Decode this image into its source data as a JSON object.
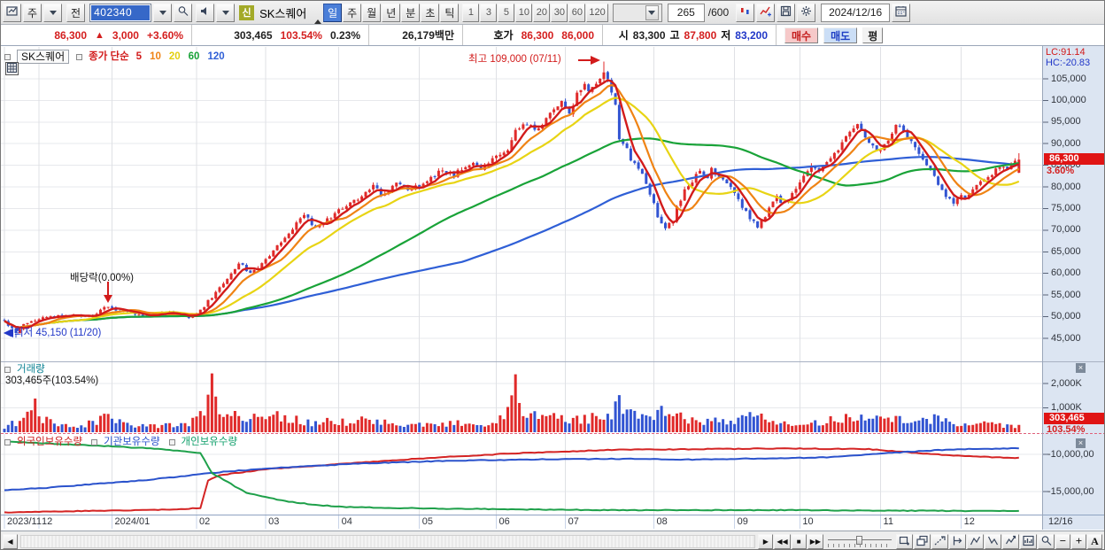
{
  "colors": {
    "up": "#e02a2a",
    "down": "#3254d2",
    "axis_bg": "#dce5f2",
    "badge_bg": "#e01414",
    "grid": "#e7e8ec",
    "divider_dotted": "#e0607a"
  },
  "toolbar": {
    "period_combo": "주",
    "prev_button": "전",
    "code_value": "402340",
    "stock_badge": "신",
    "stock_name": "SK스퀘어",
    "period_tabs": [
      "일",
      "주",
      "월",
      "년",
      "분",
      "초",
      "틱"
    ],
    "active_tab": "일",
    "minute_tabs": [
      "1",
      "3",
      "5",
      "10",
      "20",
      "30",
      "60",
      "120"
    ],
    "bar_count_value": "265",
    "bar_count_max": "/600",
    "date_value": "2024/12/16"
  },
  "quote": {
    "price": "86,300",
    "arrow": "▲",
    "change": "3,000",
    "change_pct": "+3.60%",
    "volume": "303,465",
    "volume_ratio": "103.54%",
    "turnover_pct": "0.23%",
    "value_label": "26,179백만",
    "hoga_label": "호가",
    "ask": "86,300",
    "bid": "86,000",
    "open_label": "시",
    "open": "83,300",
    "high_label": "고",
    "high": "87,800",
    "low_label": "저",
    "low": "83,200",
    "buy_button": "매수",
    "sell_button": "매도",
    "avg_button": "평"
  },
  "main_panel": {
    "legend_name": "SK스퀘어",
    "ma_label": "종가 단순",
    "ma_legend": [
      {
        "label": "5",
        "color": "#d21b1b"
      },
      {
        "label": "10",
        "color": "#ef8314"
      },
      {
        "label": "20",
        "color": "#e3cf10"
      },
      {
        "label": "60",
        "color": "#19a338"
      },
      {
        "label": "120",
        "color": "#2f5fd6"
      }
    ],
    "annotations": {
      "high": "최고 109,000 (07/11)",
      "dividend": "배당락(0.00%)",
      "low_arrow": "◀",
      "low": "최저 45,150 (11/20)"
    },
    "lc_label": "LC:91.14",
    "hc_label": "HC:-20.83",
    "price_badge": "86,300",
    "pct_badge": "3.60%",
    "y_ticks": [
      "105,000",
      "100,000",
      "95,000",
      "90,000",
      "85,000",
      "80,000",
      "75,000",
      "70,000",
      "65,000",
      "60,000",
      "55,000",
      "50,000",
      "45,000"
    ]
  },
  "volume_panel": {
    "legend": "거래량",
    "value_text": "303,465주(103.54%)",
    "y_ticks": [
      "2,000K",
      "1,000K"
    ],
    "badge": "303,465",
    "badge_pct": "103.54%"
  },
  "ownership_panel": {
    "legends": [
      {
        "label": "외국인보유수량",
        "color": "#cc2020"
      },
      {
        "label": "기관보유수량",
        "color": "#2a52cc"
      },
      {
        "label": "개인보유수량",
        "color": "#0f9f6a"
      }
    ],
    "y_ticks": [
      "-10,000,00",
      "-15,000,00"
    ]
  },
  "x_axis": {
    "labels": [
      {
        "text": "2023/11",
        "idx": 0
      },
      {
        "text": "12",
        "idx": 9
      },
      {
        "text": "2024/01",
        "idx": 28
      },
      {
        "text": "02",
        "idx": 50
      },
      {
        "text": "03",
        "idx": 68
      },
      {
        "text": "04",
        "idx": 87
      },
      {
        "text": "05",
        "idx": 108
      },
      {
        "text": "06",
        "idx": 128
      },
      {
        "text": "07",
        "idx": 146
      },
      {
        "text": "08",
        "idx": 169
      },
      {
        "text": "09",
        "idx": 190
      },
      {
        "text": "10",
        "idx": 207
      },
      {
        "text": "11",
        "idx": 228
      },
      {
        "text": "12",
        "idx": 249
      }
    ],
    "end_label": "12/16"
  },
  "panel_close_glyph": "×",
  "bottom_bar": {
    "scroll_left_glyph": "◀",
    "media": [
      {
        "name": "play-button",
        "glyph": "▶"
      },
      {
        "name": "rewind-button",
        "glyph": "◀◀"
      },
      {
        "name": "stop-button",
        "glyph": "■"
      },
      {
        "name": "fast-forward-button",
        "glyph": "▶▶"
      }
    ],
    "tools": [
      "window-add",
      "window-cascade",
      "trend-line",
      "scale-left",
      "scale-peak",
      "scale-trough",
      "scale-free",
      "chart-image",
      "magnifier"
    ],
    "zoom_out": "−",
    "zoom_in": "+",
    "font_button": "A"
  },
  "chart_data": {
    "type": "candlestick+volume+lines",
    "bars_total": 265,
    "price_range": [
      45000,
      105000
    ],
    "ma_periods": [
      5,
      10,
      20,
      60,
      120
    ],
    "ma_colors": {
      "5": "#d21b1b",
      "10": "#ef8314",
      "20": "#e8d414",
      "60": "#19a338",
      "120": "#2f5fd6"
    },
    "high_point": {
      "idx": 156,
      "price": 109000,
      "date": "07/11"
    },
    "low_point": {
      "idx": 3,
      "price": 45150,
      "date": "11/20"
    },
    "dividend_idx": 27,
    "last_ohlc": {
      "open": 83300,
      "high": 87800,
      "low": 83200,
      "close": 86300
    },
    "price_anchors": [
      [
        0,
        49000
      ],
      [
        3,
        46200
      ],
      [
        5,
        48300
      ],
      [
        9,
        49600
      ],
      [
        17,
        50300
      ],
      [
        23,
        50100
      ],
      [
        27,
        52600
      ],
      [
        30,
        51300
      ],
      [
        37,
        50300
      ],
      [
        43,
        51000
      ],
      [
        48,
        49900
      ],
      [
        51,
        51500
      ],
      [
        54,
        54500
      ],
      [
        58,
        58500
      ],
      [
        61,
        62500
      ],
      [
        64,
        60000
      ],
      [
        67,
        62000
      ],
      [
        70,
        65500
      ],
      [
        73,
        68000
      ],
      [
        76,
        71500
      ],
      [
        78,
        73500
      ],
      [
        81,
        70500
      ],
      [
        84,
        72500
      ],
      [
        87,
        74500
      ],
      [
        90,
        76500
      ],
      [
        93,
        78000
      ],
      [
        96,
        80500
      ],
      [
        98,
        78000
      ],
      [
        102,
        80500
      ],
      [
        105,
        79500
      ],
      [
        108,
        80000
      ],
      [
        111,
        82000
      ],
      [
        114,
        84000
      ],
      [
        117,
        83000
      ],
      [
        121,
        85500
      ],
      [
        124,
        84500
      ],
      [
        127,
        86500
      ],
      [
        131,
        88500
      ],
      [
        133,
        93500
      ],
      [
        136,
        94500
      ],
      [
        139,
        93000
      ],
      [
        142,
        97500
      ],
      [
        145,
        99500
      ],
      [
        147,
        97000
      ],
      [
        149,
        101500
      ],
      [
        151,
        104000
      ],
      [
        152,
        102500
      ],
      [
        154,
        104500
      ],
      [
        156,
        106500
      ],
      [
        157,
        104500
      ],
      [
        159,
        99500
      ],
      [
        160,
        91500
      ],
      [
        162,
        88500
      ],
      [
        163,
        86000
      ],
      [
        165,
        84500
      ],
      [
        167,
        80500
      ],
      [
        169,
        76500
      ],
      [
        170,
        72500
      ],
      [
        172,
        70000
      ],
      [
        174,
        72500
      ],
      [
        175,
        75500
      ],
      [
        177,
        79000
      ],
      [
        179,
        81500
      ],
      [
        181,
        83500
      ],
      [
        183,
        82000
      ],
      [
        184,
        84000
      ],
      [
        186,
        82500
      ],
      [
        188,
        80500
      ],
      [
        190,
        78500
      ],
      [
        192,
        75500
      ],
      [
        194,
        73000
      ],
      [
        196,
        70500
      ],
      [
        197,
        72000
      ],
      [
        199,
        75000
      ],
      [
        201,
        77500
      ],
      [
        203,
        76000
      ],
      [
        205,
        78500
      ],
      [
        206,
        80000
      ],
      [
        208,
        82500
      ],
      [
        210,
        84500
      ],
      [
        212,
        83500
      ],
      [
        214,
        86000
      ],
      [
        216,
        88000
      ],
      [
        218,
        90000
      ],
      [
        220,
        92500
      ],
      [
        222,
        94500
      ],
      [
        223,
        93000
      ],
      [
        225,
        90500
      ],
      [
        227,
        88000
      ],
      [
        229,
        89500
      ],
      [
        231,
        92000
      ],
      [
        232,
        94500
      ],
      [
        234,
        93000
      ],
      [
        236,
        90500
      ],
      [
        238,
        88000
      ],
      [
        240,
        85500
      ],
      [
        242,
        83000
      ],
      [
        243,
        80500
      ],
      [
        245,
        78000
      ],
      [
        247,
        76000
      ],
      [
        249,
        78500
      ],
      [
        250,
        77000
      ],
      [
        252,
        79500
      ],
      [
        254,
        81000
      ],
      [
        256,
        82500
      ],
      [
        258,
        84000
      ],
      [
        261,
        84500
      ],
      [
        264,
        86300
      ]
    ],
    "volume_anchors_K": [
      [
        0,
        250
      ],
      [
        3,
        480
      ],
      [
        8,
        1300
      ],
      [
        9,
        1250
      ],
      [
        10,
        600
      ],
      [
        15,
        280
      ],
      [
        20,
        300
      ],
      [
        27,
        700
      ],
      [
        33,
        250
      ],
      [
        40,
        350
      ],
      [
        45,
        300
      ],
      [
        48,
        420
      ],
      [
        52,
        900
      ],
      [
        54,
        2450
      ],
      [
        55,
        1600
      ],
      [
        56,
        1300
      ],
      [
        57,
        1000
      ],
      [
        58,
        1200
      ],
      [
        60,
        900
      ],
      [
        64,
        700
      ],
      [
        67,
        550
      ],
      [
        70,
        800
      ],
      [
        73,
        600
      ],
      [
        76,
        620
      ],
      [
        80,
        420
      ],
      [
        84,
        500
      ],
      [
        87,
        480
      ],
      [
        90,
        520
      ],
      [
        93,
        560
      ],
      [
        96,
        650
      ],
      [
        100,
        420
      ],
      [
        104,
        380
      ],
      [
        108,
        400
      ],
      [
        112,
        360
      ],
      [
        116,
        420
      ],
      [
        121,
        500
      ],
      [
        125,
        380
      ],
      [
        128,
        450
      ],
      [
        131,
        900
      ],
      [
        133,
        2300
      ],
      [
        134,
        1100
      ],
      [
        136,
        1000
      ],
      [
        139,
        700
      ],
      [
        142,
        800
      ],
      [
        145,
        750
      ],
      [
        147,
        600
      ],
      [
        149,
        700
      ],
      [
        152,
        650
      ],
      [
        154,
        700
      ],
      [
        156,
        900
      ],
      [
        158,
        800
      ],
      [
        159,
        1200
      ],
      [
        160,
        1400
      ],
      [
        162,
        900
      ],
      [
        165,
        700
      ],
      [
        167,
        900
      ],
      [
        169,
        750
      ],
      [
        172,
        1100
      ],
      [
        174,
        800
      ],
      [
        177,
        650
      ],
      [
        180,
        500
      ],
      [
        183,
        550
      ],
      [
        186,
        500
      ],
      [
        189,
        450
      ],
      [
        192,
        600
      ],
      [
        196,
        800
      ],
      [
        199,
        550
      ],
      [
        203,
        450
      ],
      [
        206,
        500
      ],
      [
        208,
        600
      ],
      [
        211,
        450
      ],
      [
        214,
        500
      ],
      [
        218,
        700
      ],
      [
        222,
        800
      ],
      [
        225,
        550
      ],
      [
        229,
        600
      ],
      [
        232,
        600
      ],
      [
        236,
        500
      ],
      [
        240,
        550
      ],
      [
        243,
        700
      ],
      [
        247,
        500
      ],
      [
        250,
        450
      ],
      [
        252,
        500
      ],
      [
        256,
        400
      ],
      [
        260,
        350
      ],
      [
        264,
        303
      ]
    ],
    "last_volume_K": 303.465,
    "ownership_millions": {
      "foreign": [
        [
          0,
          -17.8
        ],
        [
          23,
          -17.6
        ],
        [
          45,
          -17.4
        ],
        [
          51,
          -17.2
        ],
        [
          53,
          -13.5
        ],
        [
          56,
          -12.8
        ],
        [
          68,
          -12
        ],
        [
          90,
          -11.2
        ],
        [
          113,
          -10.4
        ],
        [
          135,
          -9.8
        ],
        [
          158,
          -9.4
        ],
        [
          180,
          -9.3
        ],
        [
          203,
          -9.2
        ],
        [
          225,
          -9.3
        ],
        [
          237,
          -9.8
        ],
        [
          248,
          -10.2
        ],
        [
          264,
          -10.5
        ]
      ],
      "institution": [
        [
          0,
          -14.8
        ],
        [
          11,
          -14.5
        ],
        [
          23,
          -14
        ],
        [
          34,
          -13.6
        ],
        [
          45,
          -13
        ],
        [
          56,
          -12.4
        ],
        [
          68,
          -11.9
        ],
        [
          79,
          -11.6
        ],
        [
          90,
          -11.3
        ],
        [
          101,
          -11.1
        ],
        [
          113,
          -10.9
        ],
        [
          124,
          -10.8
        ],
        [
          135,
          -10.7
        ],
        [
          158,
          -10.6
        ],
        [
          180,
          -10.7
        ],
        [
          192,
          -10.6
        ],
        [
          203,
          -10.5
        ],
        [
          214,
          -10.4
        ],
        [
          225,
          -10
        ],
        [
          237,
          -9.6
        ],
        [
          248,
          -9.3
        ],
        [
          264,
          -9.2
        ]
      ],
      "individual": [
        [
          0,
          -8.3
        ],
        [
          14,
          -8.6
        ],
        [
          27,
          -8.9
        ],
        [
          41,
          -9.3
        ],
        [
          51,
          -9.8
        ],
        [
          54,
          -12.5
        ],
        [
          59,
          -14
        ],
        [
          63,
          -15.2
        ],
        [
          72,
          -16.2
        ],
        [
          81,
          -16.8
        ],
        [
          90,
          -17.1
        ],
        [
          113,
          -17.3
        ],
        [
          135,
          -17.4
        ],
        [
          158,
          -17.5
        ],
        [
          203,
          -17.5
        ],
        [
          248,
          -17.6
        ],
        [
          264,
          -17.6
        ]
      ]
    }
  }
}
